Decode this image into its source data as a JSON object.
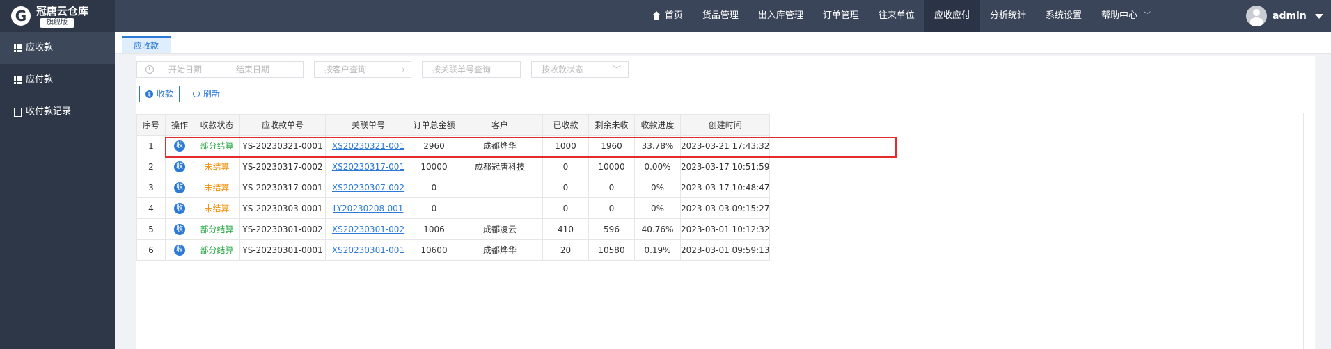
{
  "brand": {
    "name": "冠唐云仓库",
    "badge": "旗舰版",
    "mark": "G"
  },
  "nav": [
    {
      "label": "首页",
      "icon": "home-icon"
    },
    {
      "label": "货品管理"
    },
    {
      "label": "出入库管理"
    },
    {
      "label": "订单管理"
    },
    {
      "label": "往来单位"
    },
    {
      "label": "应收应付",
      "active": true
    },
    {
      "label": "分析统计"
    },
    {
      "label": "系统设置"
    },
    {
      "label": "帮助中心",
      "dropdown": true
    }
  ],
  "user": {
    "name": "admin"
  },
  "sidebar": [
    {
      "label": "应收款",
      "icon": "grid-icon",
      "active": true
    },
    {
      "label": "应付款",
      "icon": "grid-icon"
    },
    {
      "label": "收付款记录",
      "icon": "document-icon"
    }
  ],
  "tab": {
    "label": "应收款"
  },
  "filters": {
    "start_date": "开始日期",
    "separator": "-",
    "end_date": "结束日期",
    "customer": "按客户查询",
    "order_no": "按关联单号查询",
    "status": "按收款状态"
  },
  "buttons": {
    "collect": "收款",
    "refresh": "刷新"
  },
  "table": {
    "headers": [
      "序号",
      "操作",
      "收款状态",
      "应收款单号",
      "关联单号",
      "订单总金额",
      "客户",
      "已收款",
      "剩余未收",
      "收款进度",
      "创建时间"
    ],
    "action_label": "收",
    "rows": [
      {
        "no": "1",
        "status": "部分结算",
        "status_type": "part",
        "bill_no": "YS-20230321-0001",
        "order_no": "XS20230321-001",
        "total": "2960",
        "customer": "成都烨华",
        "received": "1000",
        "remaining": "1960",
        "progress": "33.78%",
        "created": "2023-03-21 17:43:32"
      },
      {
        "no": "2",
        "status": "未结算",
        "status_type": "none",
        "bill_no": "YS-20230317-0002",
        "order_no": "XS20230317-001",
        "total": "10000",
        "customer": "成都冠唐科技",
        "received": "0",
        "remaining": "10000",
        "progress": "0.00%",
        "created": "2023-03-17 10:51:59"
      },
      {
        "no": "3",
        "status": "未结算",
        "status_type": "none",
        "bill_no": "YS-20230317-0001",
        "order_no": "XS20230307-002",
        "total": "0",
        "customer": "",
        "received": "0",
        "remaining": "0",
        "progress": "0%",
        "created": "2023-03-17 10:48:47"
      },
      {
        "no": "4",
        "status": "未结算",
        "status_type": "none",
        "bill_no": "YS-20230303-0001",
        "order_no": "LY20230208-001",
        "total": "0",
        "customer": "",
        "received": "0",
        "remaining": "0",
        "progress": "0%",
        "created": "2023-03-03 09:15:27"
      },
      {
        "no": "5",
        "status": "部分结算",
        "status_type": "part",
        "bill_no": "YS-20230301-0002",
        "order_no": "XS20230301-002",
        "total": "1006",
        "customer": "成都凌云",
        "received": "410",
        "remaining": "596",
        "progress": "40.76%",
        "created": "2023-03-01 10:12:32"
      },
      {
        "no": "6",
        "status": "部分结算",
        "status_type": "part",
        "bill_no": "YS-20230301-0001",
        "order_no": "XS20230301-001",
        "total": "10600",
        "customer": "成都烨华",
        "received": "20",
        "remaining": "10580",
        "progress": "0.19%",
        "created": "2023-03-01 09:59:13"
      }
    ]
  },
  "colors": {
    "topbar": "#3a4559",
    "sidebar": "#2e3747",
    "accent": "#2d7ad6",
    "status_part": "#28a745",
    "status_none": "#f0920a",
    "highlight": "#e52c2c"
  }
}
